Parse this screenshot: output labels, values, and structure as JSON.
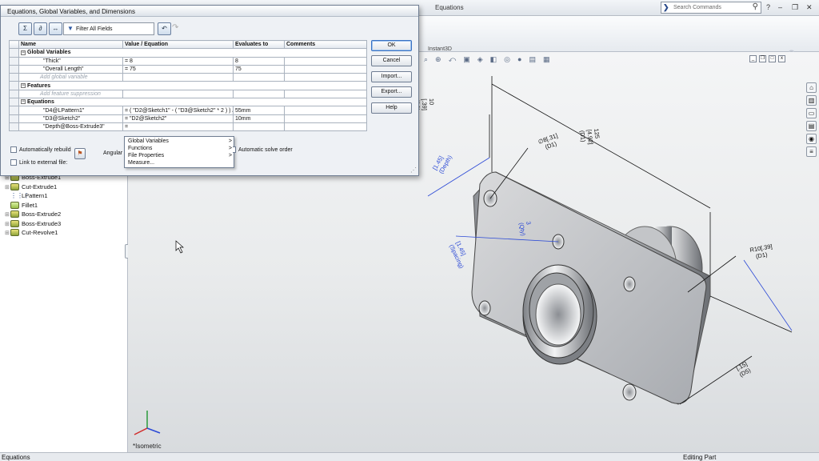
{
  "app": {
    "title": "Equations",
    "search_placeholder": "Search Commands",
    "instant3d": "Instant3D",
    "view_orientation": "*Isometric"
  },
  "status_bar": {
    "left": "Equations",
    "mode": "Editing Part"
  },
  "feature_tree": {
    "items": [
      {
        "label": "Boss-Extrude1",
        "icon": "extrude-icon"
      },
      {
        "label": "Cut-Extrude1",
        "icon": "cut-extrude-icon"
      },
      {
        "label": "LPattern1",
        "icon": "linear-pattern-icon"
      },
      {
        "label": "Fillet1",
        "icon": "fillet-icon"
      },
      {
        "label": "Boss-Extrude2",
        "icon": "extrude-icon"
      },
      {
        "label": "Boss-Extrude3",
        "icon": "extrude-icon"
      },
      {
        "label": "Cut-Revolve1",
        "icon": "revolve-cut-icon"
      }
    ]
  },
  "dialog": {
    "title": "Equations, Global Variables, and Dimensions",
    "filter_text": "Filter All Fields",
    "columns": [
      "Name",
      "Value / Equation",
      "Evaluates to",
      "Comments"
    ],
    "sections": {
      "global_variables": "Global Variables",
      "features": "Features",
      "equations": "Equations"
    },
    "global_rows": [
      {
        "name": "\"Thick\"",
        "value": "= 8",
        "evaluates": "8",
        "comment": ""
      },
      {
        "name": "\"Overall Length\"",
        "value": "= 75",
        "evaluates": "75",
        "comment": ""
      }
    ],
    "add_global_hint": "Add global variable",
    "add_feature_hint": "Add feature suppression",
    "equation_rows": [
      {
        "name": "\"D4@LPattern1\"",
        "value": "= ( \"D2@Sketch1\" - ( \"D3@Sketch2\" * 2 ) ) / 2",
        "evaluates": "55mm",
        "comment": ""
      },
      {
        "name": "\"D3@Sketch2\"",
        "value": "= \"D2@Sketch2\"",
        "evaluates": "10mm",
        "comment": ""
      },
      {
        "name": "\"Depth@Boss-Extrude3\"",
        "value": "=",
        "evaluates": "",
        "comment": ""
      }
    ],
    "dropdown": [
      "Global Variables",
      "Functions",
      "File Properties",
      "Measure..."
    ],
    "buttons": {
      "ok": "OK",
      "cancel": "Cancel",
      "import": "Import...",
      "export": "Export...",
      "help": "Help"
    },
    "auto_rebuild": "Automatically rebuild",
    "angular": "Angular",
    "auto_solve": "Automatic solve order",
    "link_external": "Link to external file:"
  },
  "dimensions": {
    "d125": "125",
    "d125_in": "[4.92]",
    "d125_name": "(D1)",
    "d10": "10",
    "d10_in": "[.39]",
    "d10_name": "(D2)",
    "dia": "∅8[.31]",
    "dia_name": "(D1)",
    "qty": "3",
    "qty_name": "(Qty)",
    "spacing": "[1.45]",
    "spacing_name": "(Spacing)",
    "depth": "[1.45]",
    "depth_name": "(Depth)",
    "r10": "R10[.39]",
    "r10_name": "(D1)",
    "d15": "[.15]",
    "d15_name": "(D5)"
  }
}
